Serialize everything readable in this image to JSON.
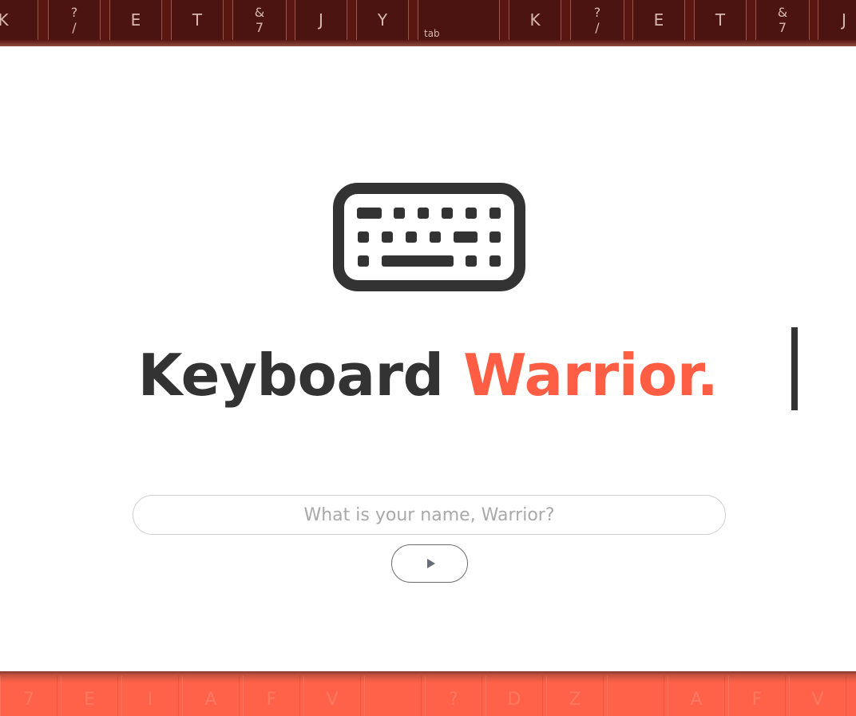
{
  "top_keys": [
    {
      "top": "",
      "main": "K"
    },
    {
      "top": "?",
      "main": "/"
    },
    {
      "top": "",
      "main": "E"
    },
    {
      "top": "",
      "main": "T"
    },
    {
      "top": "&",
      "main": "7"
    },
    {
      "top": "",
      "main": "J"
    },
    {
      "top": "",
      "main": "Y"
    },
    {
      "top": "",
      "main": "tab"
    },
    {
      "top": "",
      "main": "K"
    },
    {
      "top": "?",
      "main": "/"
    },
    {
      "top": "",
      "main": "E"
    },
    {
      "top": "",
      "main": "T"
    },
    {
      "top": "&",
      "main": "7"
    },
    {
      "top": "",
      "main": "J"
    }
  ],
  "bottom_keys": [
    "7",
    "E",
    "I",
    "A",
    "F",
    "V",
    "",
    "?",
    "D",
    "Z",
    "",
    "A",
    "F",
    "V"
  ],
  "hero": {
    "logo_icon": "keyboard-icon",
    "title_part1": "Keyboard",
    "title_part2": "Warrior."
  },
  "form": {
    "name_placeholder": "What is your name, Warrior?",
    "name_value": "",
    "submit_icon": "play-icon"
  },
  "colors": {
    "accent": "#ff5e45",
    "text_dark": "#333333",
    "key_strip": "#5a1712"
  }
}
